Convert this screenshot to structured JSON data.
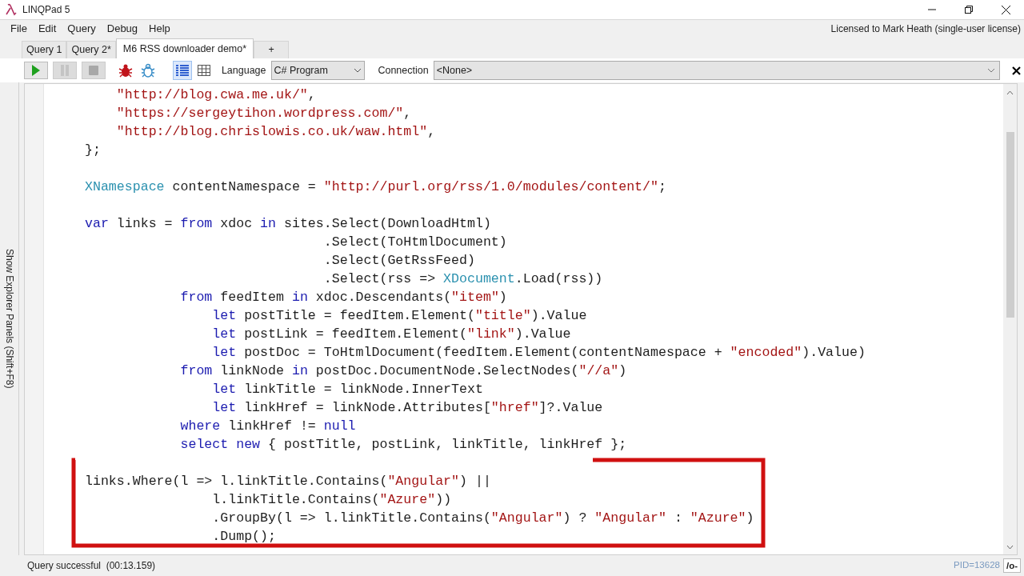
{
  "window": {
    "title": "LINQPad 5"
  },
  "menu": [
    "File",
    "Edit",
    "Query",
    "Debug",
    "Help"
  ],
  "license": "Licensed to Mark Heath (single-user license)",
  "tabs": [
    {
      "label": "Query 1",
      "selected": false
    },
    {
      "label": "Query 2*",
      "selected": false
    },
    {
      "label": "M6 RSS downloader demo*",
      "selected": true
    },
    {
      "label": "+",
      "selected": false
    }
  ],
  "toolbar": {
    "result_views": [
      {
        "kind": "rich",
        "selected": true
      },
      {
        "kind": "grid",
        "selected": false
      }
    ],
    "language_label": "Language",
    "language": "C# Program",
    "connection_label": "Connection",
    "connection": "<None>"
  },
  "side_panel_label": "Show Explorer Panels  (Shift+F8)",
  "code": [
    {
      "kind": "code",
      "segments": [
        {
          "kind": "string",
          "text": "    \"http://blog.cwa.me.uk/\""
        },
        {
          "kind": "plain",
          "text": ","
        }
      ]
    },
    {
      "kind": "code",
      "segments": [
        {
          "kind": "string",
          "text": "    \"https://sergeytihon.wordpress.com/\""
        },
        {
          "kind": "plain",
          "text": ","
        }
      ]
    },
    {
      "kind": "code",
      "segments": [
        {
          "kind": "string",
          "text": "    \"http://blog.chrislowis.co.uk/waw.html\""
        },
        {
          "kind": "plain",
          "text": ","
        }
      ]
    },
    {
      "kind": "code",
      "segments": [
        {
          "kind": "plain",
          "text": "};"
        }
      ]
    },
    {
      "kind": "blank"
    },
    {
      "kind": "code",
      "segments": [
        {
          "kind": "type",
          "text": "XNamespace"
        },
        {
          "kind": "plain",
          "text": " contentNamespace = "
        },
        {
          "kind": "string",
          "text": "\"http://purl.org/rss/1.0/modules/content/\""
        },
        {
          "kind": "plain",
          "text": ";"
        }
      ]
    },
    {
      "kind": "blank"
    },
    {
      "kind": "code",
      "segments": [
        {
          "kind": "keyword",
          "text": "var"
        },
        {
          "kind": "plain",
          "text": " links = "
        },
        {
          "kind": "keyword",
          "text": "from"
        },
        {
          "kind": "plain",
          "text": " xdoc "
        },
        {
          "kind": "keyword",
          "text": "in"
        },
        {
          "kind": "plain",
          "text": " sites.Select(DownloadHtml)"
        }
      ]
    },
    {
      "kind": "code",
      "segments": [
        {
          "kind": "plain",
          "text": "                              .Select(ToHtmlDocument)"
        }
      ]
    },
    {
      "kind": "code",
      "segments": [
        {
          "kind": "plain",
          "text": "                              .Select(GetRssFeed)"
        }
      ]
    },
    {
      "kind": "code",
      "segments": [
        {
          "kind": "plain",
          "text": "                              .Select(rss => "
        },
        {
          "kind": "type",
          "text": "XDocument"
        },
        {
          "kind": "plain",
          "text": ".Load(rss))"
        }
      ]
    },
    {
      "kind": "code",
      "segments": [
        {
          "kind": "keyword",
          "text": "            from"
        },
        {
          "kind": "plain",
          "text": " feedItem "
        },
        {
          "kind": "keyword",
          "text": "in"
        },
        {
          "kind": "plain",
          "text": " xdoc.Descendants("
        },
        {
          "kind": "string",
          "text": "\"item\""
        },
        {
          "kind": "plain",
          "text": ")"
        }
      ]
    },
    {
      "kind": "code",
      "segments": [
        {
          "kind": "keyword",
          "text": "                let"
        },
        {
          "kind": "plain",
          "text": " postTitle = feedItem.Element("
        },
        {
          "kind": "string",
          "text": "\"title\""
        },
        {
          "kind": "plain",
          "text": ").Value"
        }
      ]
    },
    {
      "kind": "code",
      "segments": [
        {
          "kind": "keyword",
          "text": "                let"
        },
        {
          "kind": "plain",
          "text": " postLink = feedItem.Element("
        },
        {
          "kind": "string",
          "text": "\"link\""
        },
        {
          "kind": "plain",
          "text": ").Value"
        }
      ]
    },
    {
      "kind": "code",
      "segments": [
        {
          "kind": "keyword",
          "text": "                let"
        },
        {
          "kind": "plain",
          "text": " postDoc = ToHtmlDocument(feedItem.Element(contentNamespace + "
        },
        {
          "kind": "string",
          "text": "\"encoded\""
        },
        {
          "kind": "plain",
          "text": ").Value)"
        }
      ]
    },
    {
      "kind": "code",
      "segments": [
        {
          "kind": "keyword",
          "text": "            from"
        },
        {
          "kind": "plain",
          "text": " linkNode "
        },
        {
          "kind": "keyword",
          "text": "in"
        },
        {
          "kind": "plain",
          "text": " postDoc.DocumentNode.SelectNodes("
        },
        {
          "kind": "string",
          "text": "\"//a\""
        },
        {
          "kind": "plain",
          "text": ")"
        }
      ]
    },
    {
      "kind": "code",
      "segments": [
        {
          "kind": "keyword",
          "text": "                let"
        },
        {
          "kind": "plain",
          "text": " linkTitle = linkNode.InnerText"
        }
      ]
    },
    {
      "kind": "code",
      "segments": [
        {
          "kind": "keyword",
          "text": "                let"
        },
        {
          "kind": "plain",
          "text": " linkHref = linkNode.Attributes["
        },
        {
          "kind": "string",
          "text": "\"href\""
        },
        {
          "kind": "plain",
          "text": "]?.Value"
        }
      ]
    },
    {
      "kind": "code",
      "segments": [
        {
          "kind": "keyword",
          "text": "            where"
        },
        {
          "kind": "plain",
          "text": " linkHref != "
        },
        {
          "kind": "keyword",
          "text": "null"
        }
      ]
    },
    {
      "kind": "code",
      "segments": [
        {
          "kind": "keyword",
          "text": "            select new"
        },
        {
          "kind": "plain",
          "text": " { postTitle, postLink, linkTitle, linkHref };"
        }
      ]
    },
    {
      "kind": "blank"
    },
    {
      "kind": "code",
      "segments": [
        {
          "kind": "plain",
          "text": "links.Where(l => l.linkTitle.Contains("
        },
        {
          "kind": "string",
          "text": "\"Angular\""
        },
        {
          "kind": "plain",
          "text": ") ||"
        }
      ]
    },
    {
      "kind": "code",
      "segments": [
        {
          "kind": "plain",
          "text": "                l.linkTitle.Contains("
        },
        {
          "kind": "string",
          "text": "\"Azure\""
        },
        {
          "kind": "plain",
          "text": "))"
        }
      ]
    },
    {
      "kind": "code",
      "segments": [
        {
          "kind": "plain",
          "text": "                .GroupBy(l => l.linkTitle.Contains("
        },
        {
          "kind": "string",
          "text": "\"Angular\""
        },
        {
          "kind": "plain",
          "text": ") ? "
        },
        {
          "kind": "string",
          "text": "\"Angular\""
        },
        {
          "kind": "plain",
          "text": " : "
        },
        {
          "kind": "string",
          "text": "\"Azure\""
        },
        {
          "kind": "plain",
          "text": ")"
        }
      ]
    },
    {
      "kind": "code",
      "segments": [
        {
          "kind": "plain",
          "text": "                .Dump();"
        }
      ]
    }
  ],
  "status_bar": {
    "message": "Query successful  (00:13.159)",
    "pid": "PID=13628",
    "mode": "/o-"
  }
}
